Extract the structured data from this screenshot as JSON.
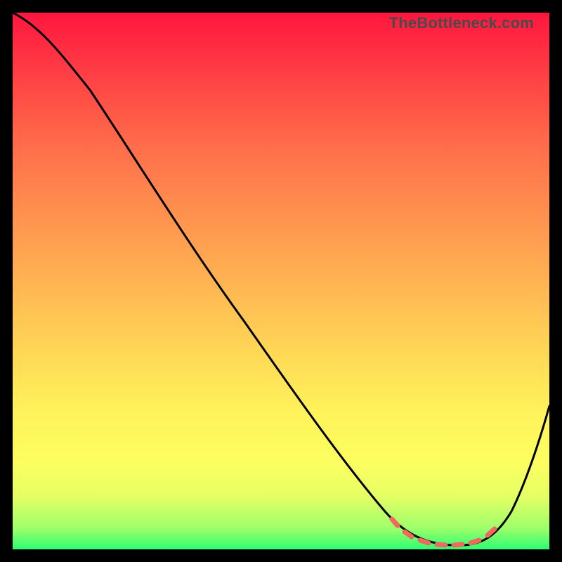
{
  "brand": "TheBottleneck.com",
  "chart_data": {
    "type": "line",
    "title": "",
    "xlabel": "",
    "ylabel": "",
    "xlim": [
      0,
      100
    ],
    "ylim": [
      0,
      100
    ],
    "series": [
      {
        "name": "bottleneck-curve",
        "color": "#000000",
        "x": [
          0,
          5,
          12,
          20,
          30,
          40,
          50,
          60,
          68,
          72,
          76,
          80,
          84,
          88,
          92,
          96,
          100
        ],
        "values": [
          100,
          98,
          94,
          87,
          76,
          64,
          52,
          38,
          24,
          14,
          6,
          2,
          1,
          1,
          4,
          14,
          30
        ]
      },
      {
        "name": "optimal-band",
        "color": "#ee6a5f",
        "style": "dotted",
        "x": [
          74,
          76,
          78,
          80,
          82,
          84,
          86,
          88,
          90
        ],
        "values": [
          8,
          6,
          4,
          2,
          1,
          1,
          2,
          3,
          6
        ]
      }
    ],
    "grid": false,
    "legend": false,
    "background": "rainbow-gradient"
  }
}
